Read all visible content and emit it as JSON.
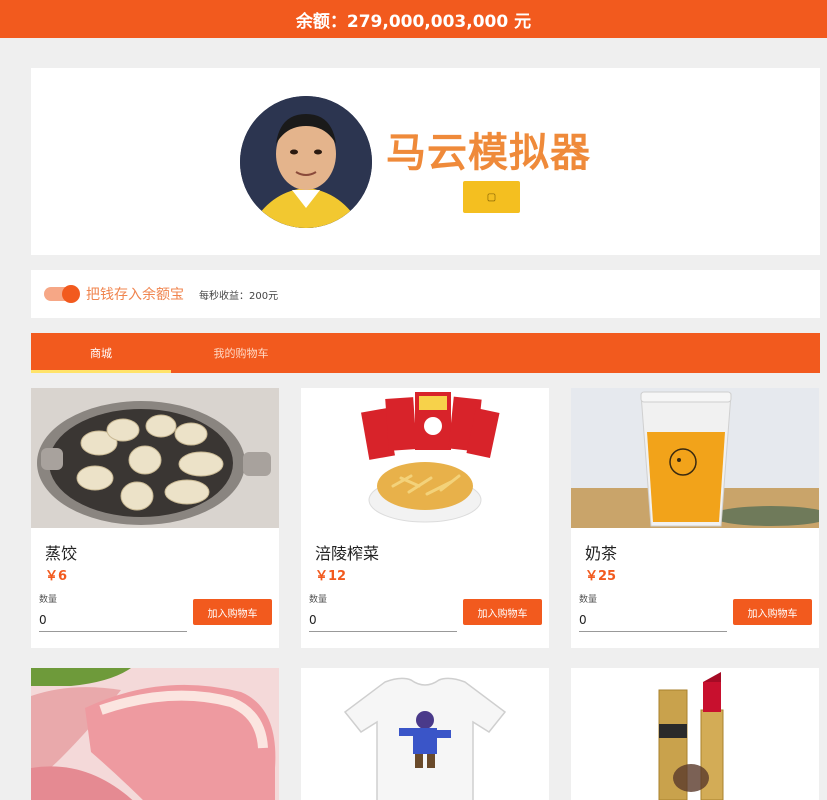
{
  "header": {
    "balance_text": "余额：279,000,003,000 元"
  },
  "hero": {
    "title": "马云模拟器",
    "button_label": "▢"
  },
  "savings": {
    "toggle_label": "把钱存入余额宝",
    "earnings_text": "每秒收益：200元",
    "toggle_on": true
  },
  "tabs": [
    {
      "label": "商城",
      "active": true
    },
    {
      "label": "我的购物车",
      "active": false
    }
  ],
  "products": [
    {
      "name": "蒸饺",
      "price": "￥6",
      "qty_label": "数量",
      "qty": "0",
      "add_label": "加入购物车"
    },
    {
      "name": "涪陵榨菜",
      "price": "￥12",
      "qty_label": "数量",
      "qty": "0",
      "add_label": "加入购物车"
    },
    {
      "name": "奶茶",
      "price": "￥25",
      "qty_label": "数量",
      "qty": "0",
      "add_label": "加入购物车"
    },
    {
      "name": "",
      "price": "",
      "qty_label": "",
      "qty": "",
      "add_label": ""
    },
    {
      "name": "",
      "price": "",
      "qty_label": "",
      "qty": "",
      "add_label": ""
    },
    {
      "name": "",
      "price": "",
      "qty_label": "",
      "qty": "",
      "add_label": ""
    }
  ],
  "colors": {
    "accent": "#f25a1e",
    "title": "#ef8a3a",
    "button": "#f4bf20",
    "background": "#efefef"
  }
}
